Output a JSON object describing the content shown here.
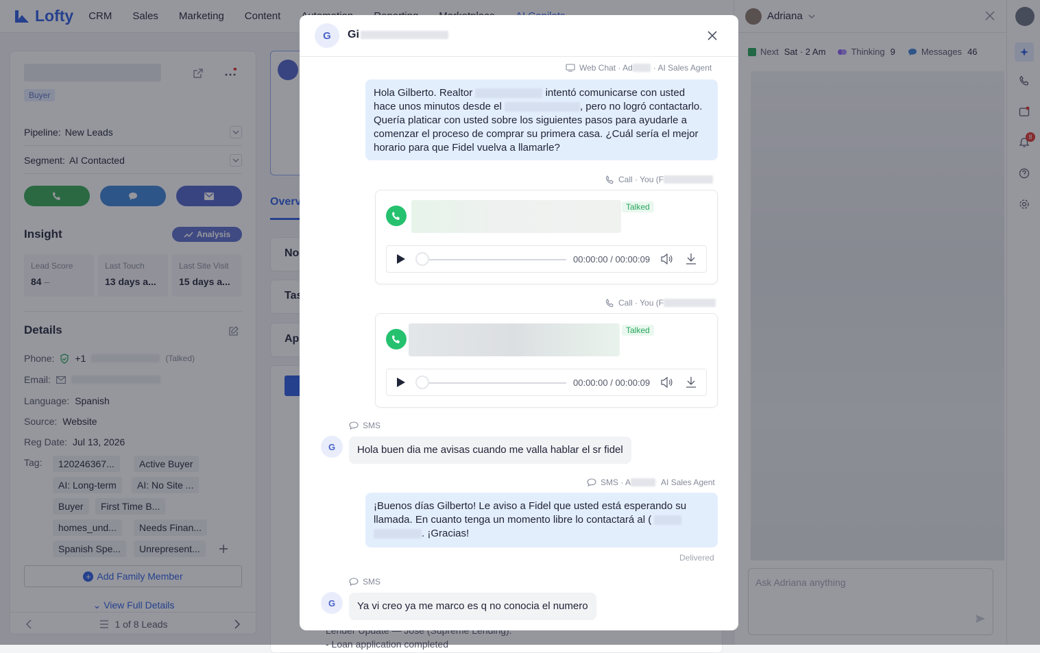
{
  "nav": {
    "brand": "Lofty",
    "items": [
      "CRM",
      "Sales",
      "Marketing",
      "Content",
      "Automation",
      "Reporting",
      "Marketplace",
      "AI Copilots"
    ]
  },
  "lead": {
    "type_tag": "Buyer",
    "pipeline_label": "Pipeline:",
    "pipeline_value": "New Leads",
    "segment_label": "Segment:",
    "segment_value": "AI Contacted",
    "insight_title": "Insight",
    "analysis_label": "Analysis",
    "stats": [
      {
        "label": "Lead Score",
        "value": "84"
      },
      {
        "label": "Last Touch",
        "value": "13 days a..."
      },
      {
        "label": "Last Site Visit",
        "value": "15 days a..."
      }
    ],
    "details_title": "Details",
    "phone_label": "Phone:",
    "phone_value": "+1",
    "phone_status": "(Talked)",
    "email_label": "Email:",
    "language_label": "Language:",
    "language_value": "Spanish",
    "source_label": "Source:",
    "source_value": "Website",
    "regdate_label": "Reg Date:",
    "regdate_value": "Jul 13, 2026",
    "tag_label": "Tag:",
    "tags": [
      "120246367...",
      "Active Buyer",
      "AI: Long-term",
      "AI: No Site ...",
      "Buyer",
      "First Time B...",
      "homes_und...",
      "Needs Finan...",
      "Spanish Spe...",
      "Unrepresent..."
    ],
    "add_family": "Add Family Member",
    "view_full": "View Full Details",
    "pager": "1 of 8 Leads"
  },
  "middle": {
    "tab_overview": "Overv",
    "rows": [
      "No",
      "Tas",
      "Ap"
    ],
    "note_line1": "Lender Update — Jose (Supreme Lending):",
    "note_line2": "- Loan application completed"
  },
  "copilot": {
    "agent_name": "Adriana",
    "next_label": "Next",
    "next_value": "Sat · 2 Am",
    "thinking_label": "Thinking",
    "thinking_count": "9",
    "messages_label": "Messages",
    "messages_count": "46",
    "ask_placeholder": "Ask Adriana  anything",
    "notification_count": "8"
  },
  "modal": {
    "avatar_letter": "G",
    "name_visible": "Gi",
    "messages": [
      {
        "kind": "out",
        "meta_channel": "Web Chat · Ad",
        "meta_agent": "· AI Sales Agent",
        "text_a": "Hola Gilberto. Realtor",
        "text_b": "intentó comunicarse con usted hace unos minutos desde el",
        "text_c": ", pero no logró contactarlo. Quería platicar con usted sobre los siguientes pasos para ayudarle a comenzar el proceso de comprar su primera casa. ¿Cuál sería el mejor horario para que Fidel vuelva a llamarle?"
      },
      {
        "kind": "call",
        "meta": "Call · You (F",
        "status": "Talked",
        "time": "00:00:00 / 00:00:09"
      },
      {
        "kind": "call",
        "meta": "Call · You (F",
        "status": "Talked",
        "time": "00:00:00 / 00:00:09"
      },
      {
        "kind": "in",
        "meta": "SMS",
        "avatar": "G",
        "text": "Hola buen dia me avisas cuando me valla hablar el sr fidel"
      },
      {
        "kind": "out",
        "meta_channel": "SMS · A",
        "meta_agent": "AI Sales Agent",
        "text_a": "¡Buenos días Gilberto! Le aviso a Fidel que usted está esperando su llamada. En cuanto tenga un momento libre lo contactará al (",
        "text_b": ". ¡Gracias!",
        "status": "Delivered"
      },
      {
        "kind": "in",
        "meta": "SMS",
        "avatar": "G",
        "text": "Ya vi creo ya me marco es q no conocia el numero"
      }
    ]
  },
  "colors": {
    "brand_blue": "#2b5ce0",
    "call_green": "#35a853",
    "sms_blue": "#3b82d6",
    "email_indigo": "#4f63c9",
    "outgoing_bubble": "#e3eefd",
    "talked_green": "#25a55c"
  }
}
